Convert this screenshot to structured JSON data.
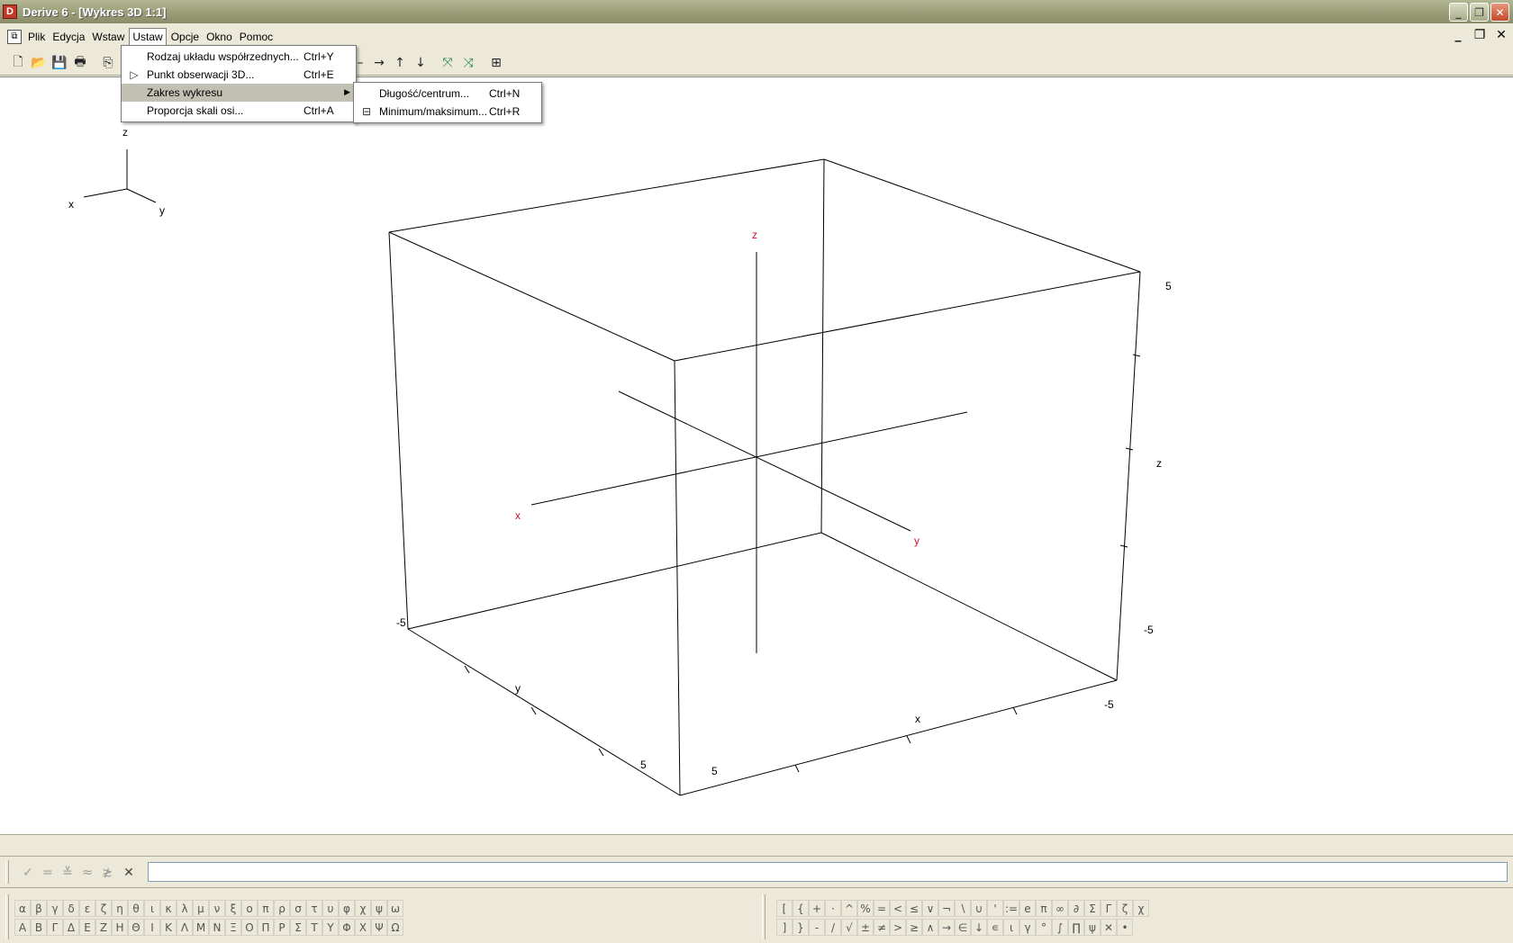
{
  "window": {
    "title": "Derive 6 - [Wykres 3D 1:1]",
    "app_icon_letter": "D",
    "controls": [
      "minimize",
      "restore",
      "close"
    ]
  },
  "menubar": {
    "items": [
      "Plik",
      "Edycja",
      "Wstaw",
      "Ustaw",
      "Opcje",
      "Okno",
      "Pomoc"
    ],
    "active": "Ustaw"
  },
  "ustaw_menu": {
    "items": [
      {
        "label": "Rodzaj układu współrzednych...",
        "shortcut": "Ctrl+Y",
        "icon": ""
      },
      {
        "label": "Punkt obserwacji 3D...",
        "shortcut": "Ctrl+E",
        "icon": "eye-point-icon"
      },
      {
        "label": "Zakres wykresu",
        "shortcut": "",
        "icon": "",
        "submenu": true
      },
      {
        "label": "Proporcja skali osi...",
        "shortcut": "Ctrl+A",
        "icon": ""
      }
    ]
  },
  "zakres_submenu": {
    "items": [
      {
        "label": "Długość/centrum...",
        "shortcut": "Ctrl+N",
        "icon": ""
      },
      {
        "label": "Minimum/maksimum...",
        "shortcut": "Ctrl+R",
        "icon": "range-box-icon"
      }
    ]
  },
  "plot": {
    "orientation_labels": {
      "x": "x",
      "y": "y",
      "z": "z"
    },
    "inner_axis_labels": {
      "x": "x",
      "y": "y",
      "z": "z"
    },
    "box_labels": {
      "z_axis": "z",
      "z_max": "5",
      "z_min": "-5",
      "x_axis": "x",
      "x_min": "-5",
      "x_max": "5",
      "y_axis": "y",
      "y_min": "-5",
      "y_max": "5"
    },
    "colors": {
      "box": "#000000",
      "inner_axes": "#000000",
      "inner_labels": "#c8102e"
    }
  },
  "entry": {
    "value": "",
    "buttons": [
      "✓",
      "=",
      "≚",
      "≈",
      "≵",
      "✕"
    ]
  },
  "greek_lower": [
    "α",
    "β",
    "γ",
    "δ",
    "ε",
    "ζ",
    "η",
    "θ",
    "ι",
    "κ",
    "λ",
    "μ",
    "ν",
    "ξ",
    "ο",
    "π",
    "ρ",
    "σ",
    "τ",
    "υ",
    "φ",
    "χ",
    "ψ",
    "ω"
  ],
  "greek_upper": [
    "Α",
    "Β",
    "Γ",
    "Δ",
    "Ε",
    "Ζ",
    "Η",
    "Θ",
    "Ι",
    "Κ",
    "Λ",
    "Μ",
    "Ν",
    "Ξ",
    "Ο",
    "Π",
    "Ρ",
    "Σ",
    "Τ",
    "Υ",
    "Φ",
    "Χ",
    "Ψ",
    "Ω"
  ],
  "math_row1": [
    "[",
    "{",
    "+",
    "·",
    "^",
    "%",
    "=",
    "<",
    "≤",
    "∨",
    "¬",
    "∖",
    "∪",
    "'",
    ":=",
    "e",
    "π",
    "∞",
    "∂",
    "Σ",
    "Γ",
    "ζ",
    "χ"
  ],
  "math_row2": [
    "]",
    "}",
    "-",
    "/",
    "√",
    "±",
    "≠",
    ">",
    "≥",
    "∧",
    "→",
    "∈",
    "↓",
    "∊",
    "ι",
    "γ",
    "°",
    "∫",
    "∏",
    "ψ",
    "✕",
    "•"
  ]
}
